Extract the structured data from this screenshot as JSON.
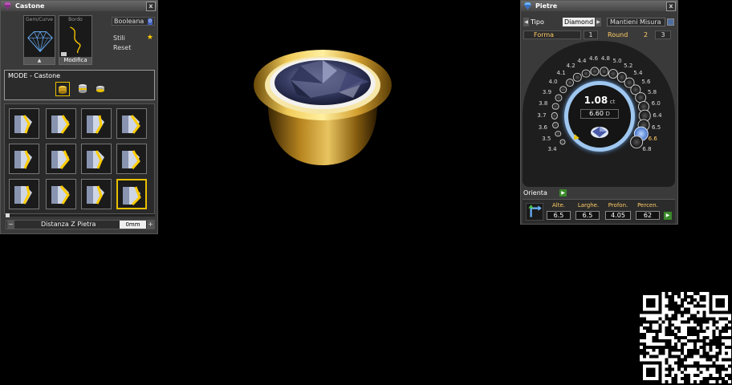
{
  "castone": {
    "title": "Castone",
    "close": "x",
    "gem_curve_label": "Gem/Curve",
    "bordo_label": "Bordo",
    "booleana_label": "Booleana",
    "booleana_badge": "0",
    "stili_label": "Stili",
    "reset_label": "Reset",
    "modifica_label": "Modifica",
    "mode_label": "MODE - Castone",
    "distanza_label": "Distanza Z Pietra",
    "distanza_value": "0mm",
    "minus": "−",
    "plus": "+"
  },
  "pietre": {
    "title": "Pietre",
    "close": "x",
    "tipo_label": "Tipo",
    "tipo_value": "Diamond",
    "mantieni_label": "Mantieni Misura",
    "forma_label": "Forma",
    "forma_value": "1",
    "round_label": "Round",
    "round_value_2": "2",
    "round_value_3": "3",
    "carat_value": "1.08",
    "carat_unit": "ct",
    "diameter_value": "6.60",
    "diameter_unit": "D",
    "sizes": [
      "3.4",
      "3.5",
      "3.6",
      "3.7",
      "3.8",
      "3.9",
      "4.0",
      "4.1",
      "4.2",
      "4.4",
      "4.6",
      "4.8",
      "5.0",
      "5.2",
      "5.4",
      "5.6",
      "5.8",
      "6.0",
      "6.4",
      "6.5",
      "6.6",
      "6.8"
    ],
    "selected_size": "6.6",
    "orienta_label": "Orienta",
    "fields": {
      "alte_label": "Alte.",
      "alte_value": "6.5",
      "larghe_label": "Larghe.",
      "larghe_value": "6.5",
      "profon_label": "Profon.",
      "profon_value": "4.05",
      "percen_label": "Percen.",
      "percen_value": "62"
    }
  },
  "colors": {
    "accent": "#e8c000",
    "panel_bg": "#3a3a3a",
    "ring_blue": "#9fc7f0",
    "label_orange": "#ffcc66"
  },
  "icons": [
    "close-icon",
    "gem-icon",
    "curve-icon",
    "star-icon",
    "folder-icon",
    "bezel-icon",
    "cylinder-icon",
    "stone-icon",
    "orient-icon",
    "qr-code-icon"
  ]
}
